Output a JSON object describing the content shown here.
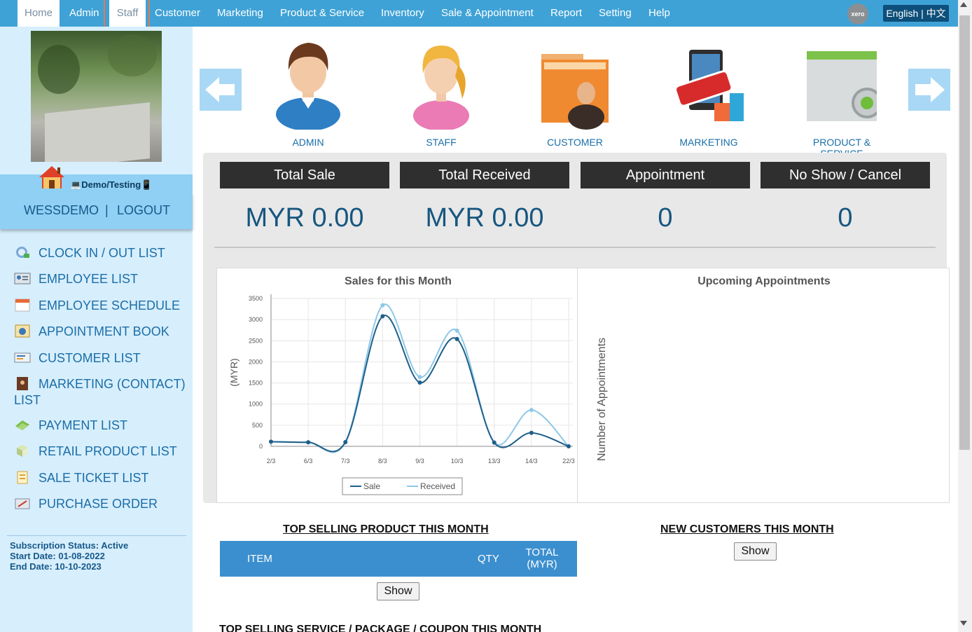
{
  "nav": {
    "items": [
      {
        "label": "Home",
        "left": 25
      },
      {
        "label": "Admin",
        "left": 99
      },
      {
        "label": "Staff",
        "left": 156
      },
      {
        "label": "Customer",
        "left": 221
      },
      {
        "label": "Marketing",
        "left": 310
      },
      {
        "label": "Product & Service",
        "left": 400
      },
      {
        "label": "Inventory",
        "left": 544
      },
      {
        "label": "Sale & Appointment",
        "left": 630
      },
      {
        "label": "Report",
        "left": 786
      },
      {
        "label": "Setting",
        "left": 855
      },
      {
        "label": "Help",
        "left": 926
      }
    ],
    "xero_label": "xero",
    "language": "English | 中文"
  },
  "sidebar": {
    "demo_label": "Demo/Testing",
    "username": "WESSDEMO",
    "separator": "|",
    "logout": "LOGOUT",
    "menu": [
      {
        "label": "CLOCK IN / OUT LIST",
        "icon": "clock-globe-icon"
      },
      {
        "label": "EMPLOYEE LIST",
        "icon": "employee-card-icon"
      },
      {
        "label": "EMPLOYEE SCHEDULE",
        "icon": "calendar-icon"
      },
      {
        "label": "APPOINTMENT BOOK",
        "icon": "appointment-book-icon"
      },
      {
        "label": "CUSTOMER LIST",
        "icon": "customer-card-icon"
      },
      {
        "label": "MARKETING (CONTACT) LIST",
        "icon": "contact-book-icon"
      },
      {
        "label": "PAYMENT LIST",
        "icon": "money-icon"
      },
      {
        "label": "RETAIL PRODUCT LIST",
        "icon": "box-icon"
      },
      {
        "label": "SALE TICKET LIST",
        "icon": "receipt-icon"
      },
      {
        "label": "PURCHASE ORDER",
        "icon": "purchase-order-icon"
      }
    ],
    "subscription": {
      "status": "Subscription Status: Active",
      "start": "Start Date: 01-08-2022",
      "end": "End Date: 10-10-2023"
    }
  },
  "carousel": [
    {
      "label": "ADMIN",
      "icon": "admin-user-icon"
    },
    {
      "label": "STAFF",
      "icon": "staff-user-icon"
    },
    {
      "label": "CUSTOMER",
      "icon": "customer-folder-icon"
    },
    {
      "label": "MARKETING",
      "icon": "open-sign-shop-icon"
    },
    {
      "label": "PRODUCT & SERVICE",
      "icon": "product-gear-icon"
    }
  ],
  "stats": [
    {
      "title": "Total Sale",
      "value": "MYR 0.00"
    },
    {
      "title": "Total Received",
      "value": "MYR 0.00"
    },
    {
      "title": "Appointment",
      "value": "0"
    },
    {
      "title": "No Show / Cancel",
      "value": "0"
    }
  ],
  "chart_data": {
    "type": "line",
    "title": "Sales for this Month",
    "ylabel": "(MYR)",
    "xlabel": "",
    "x": [
      "2/3",
      "6/3",
      "7/3",
      "8/3",
      "9/3",
      "10/3",
      "13/3",
      "14/3",
      "22/3"
    ],
    "ylim": [
      0,
      3500
    ],
    "yticks": [
      0,
      500,
      1000,
      1500,
      2000,
      2500,
      3000,
      3500
    ],
    "series": [
      {
        "name": "Sale",
        "color": "#1e5f8a",
        "values": [
          110,
          95,
          100,
          3080,
          1510,
          2540,
          90,
          320,
          0
        ]
      },
      {
        "name": "Received",
        "color": "#8ec8e8",
        "values": [
          110,
          95,
          100,
          3340,
          1640,
          2740,
          90,
          860,
          0
        ]
      }
    ],
    "legend": "bottom",
    "grid": true
  },
  "appointments": {
    "title": "Upcoming Appointments",
    "ylabel": "Number of Appointments"
  },
  "top_products": {
    "title": "TOP SELLING PRODUCT THIS MONTH",
    "columns": [
      "ITEM",
      "QTY",
      "TOTAL (MYR)"
    ],
    "show": "Show"
  },
  "new_customers": {
    "title": "NEW CUSTOMERS THIS MONTH",
    "show": "Show"
  },
  "top_services": {
    "title": "TOP SELLING SERVICE / PACKAGE / COUPON THIS MONTH"
  }
}
